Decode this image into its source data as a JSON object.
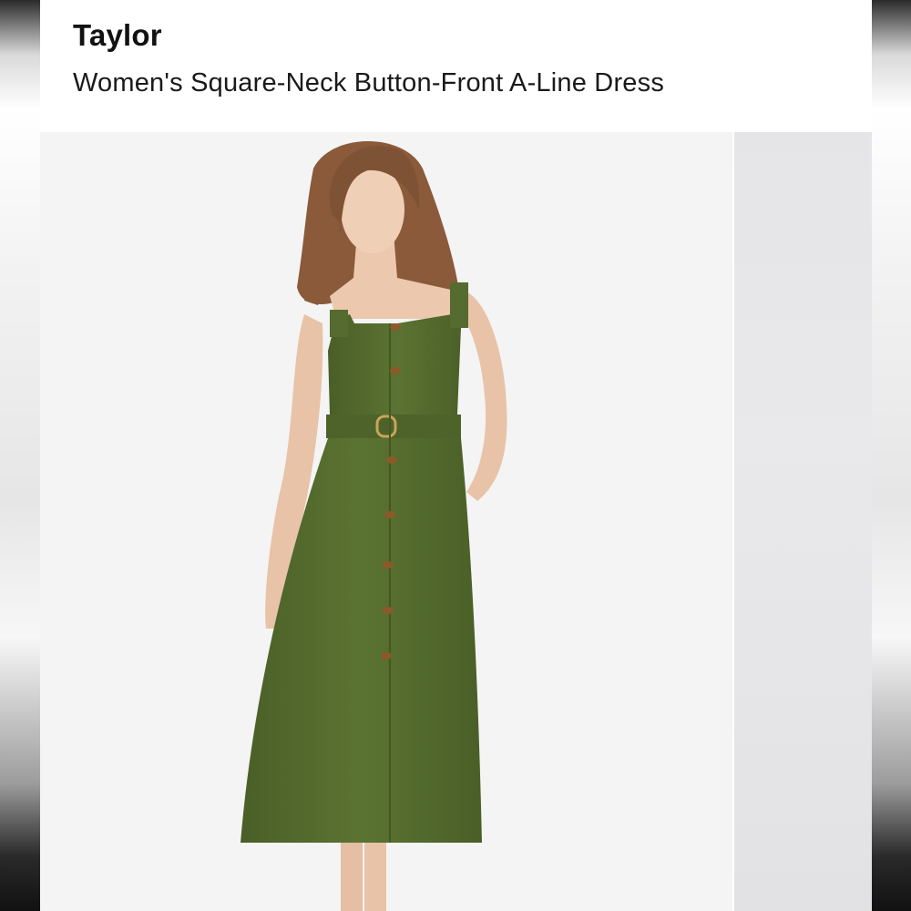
{
  "header": {
    "brand": "Taylor",
    "product_name": "Women's Square-Neck Button-Front A-Line Dress"
  },
  "gallery": {
    "main_image": "product-photo-model-green-dress",
    "next_image": "product-photo-next-preview"
  },
  "colors": {
    "dress": "#556b2f",
    "background": "#f4f4f5",
    "text": "#111111"
  }
}
